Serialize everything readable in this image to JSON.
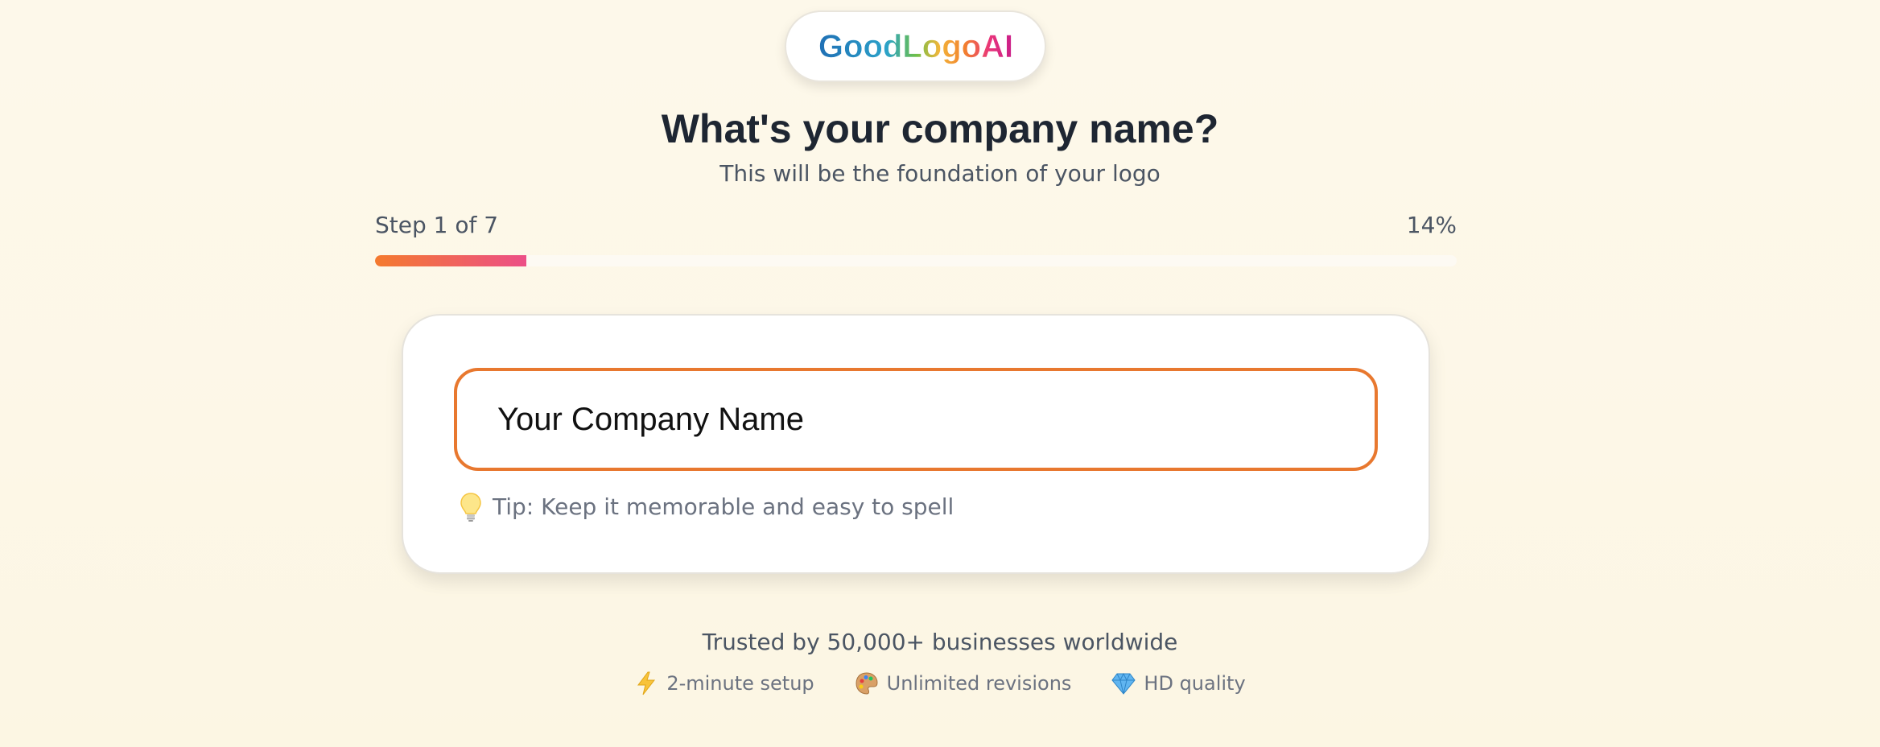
{
  "brand": {
    "logo_text": "GoodLogoAI",
    "logo_icon": "goodlogoai-wordmark"
  },
  "header": {
    "title": "What's your company name?",
    "subtitle": "This will be the foundation of your logo"
  },
  "progress": {
    "step_label": "Step 1 of 7",
    "percent_label": "14%",
    "value": 0.14,
    "colors": {
      "start": "#f47a2e",
      "end": "#ec4f87"
    }
  },
  "form": {
    "company_name_value": "Your Company Name",
    "accent_color": "#e8782f",
    "tip_icon": "lightbulb-icon",
    "tip_text": "Tip: Keep it memorable and easy to spell"
  },
  "footer": {
    "trusted_text": "Trusted by 50,000+ businesses worldwide",
    "features": [
      {
        "icon": "lightning-icon",
        "label": "2-minute setup"
      },
      {
        "icon": "palette-icon",
        "label": "Unlimited revisions"
      },
      {
        "icon": "gem-icon",
        "label": "HD quality"
      }
    ]
  }
}
